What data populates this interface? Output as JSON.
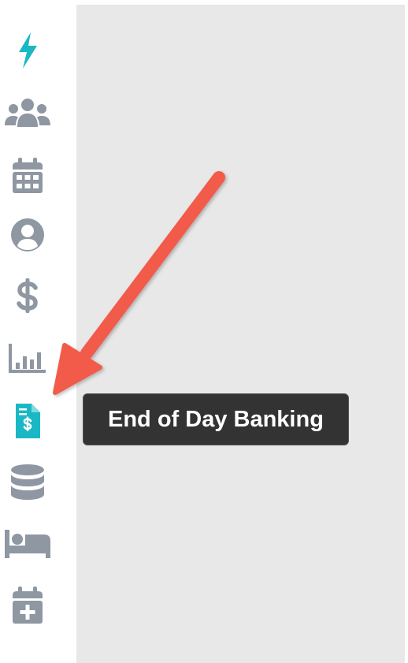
{
  "colors": {
    "accent": "#1ab8c4",
    "icon_gray": "#8e97a2",
    "content_bg": "#e8e8e8",
    "tooltip_bg": "#333333",
    "arrow": "#f25a4a"
  },
  "sidebar": {
    "items": [
      {
        "icon": "lightning-icon",
        "active": false,
        "color": "#1ab8c4"
      },
      {
        "icon": "users-icon",
        "active": false
      },
      {
        "icon": "calendar-icon",
        "active": false
      },
      {
        "icon": "user-circle-icon",
        "active": false
      },
      {
        "icon": "dollar-icon",
        "active": false
      },
      {
        "icon": "bar-chart-icon",
        "active": false
      },
      {
        "icon": "file-invoice-dollar-icon",
        "active": true
      },
      {
        "icon": "database-icon",
        "active": false
      },
      {
        "icon": "bed-icon",
        "active": false
      },
      {
        "icon": "calendar-plus-icon",
        "active": false
      }
    ]
  },
  "tooltip": {
    "text": "End of Day Banking"
  }
}
